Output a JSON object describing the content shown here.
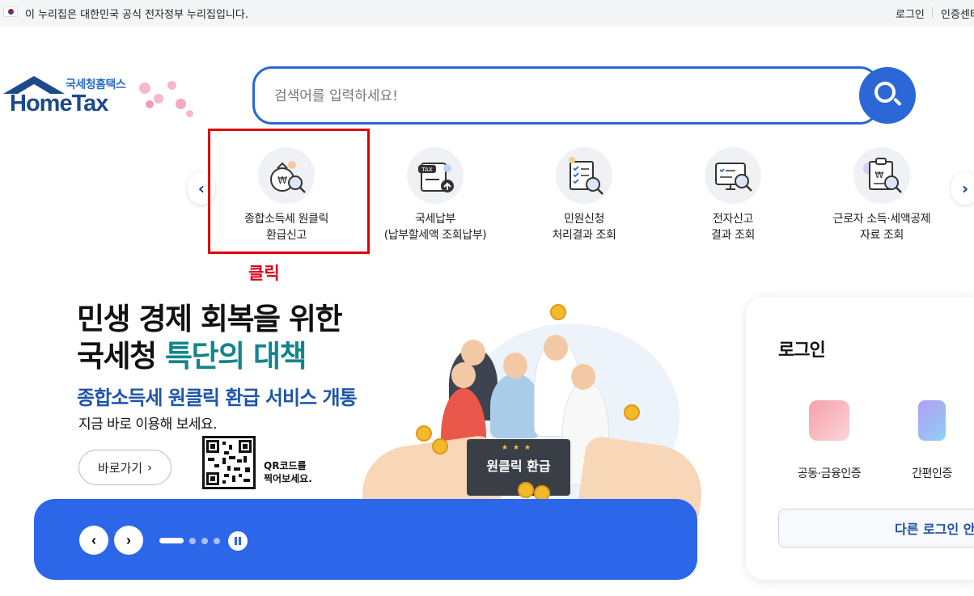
{
  "gov_banner": {
    "text": "이 누리집은 대한민국 공식 전자정부 누리집입니다.",
    "login": "로그인",
    "cert_center": "인증센터"
  },
  "logo": {
    "sub": "국세청홈택스",
    "main": "HomeTax"
  },
  "search": {
    "placeholder": "검색어를 입력하세요!"
  },
  "quick_menu": {
    "items": [
      {
        "line1": "종합소득세 원클릭",
        "line2": "환급신고",
        "icon": "money-bag-check-icon"
      },
      {
        "line1": "국세납부",
        "line2": "(납부할세액 조회납부)",
        "icon": "tax-document-upload-icon"
      },
      {
        "line1": "민원신청",
        "line2": "처리결과 조회",
        "icon": "checklist-search-icon"
      },
      {
        "line1": "전자신고",
        "line2": "결과 조회",
        "icon": "monitor-search-icon"
      },
      {
        "line1": "근로자 소득·세액공제",
        "line2": "자료 조회",
        "icon": "clipboard-won-search-icon"
      }
    ]
  },
  "annotation": {
    "click_note": "클릭",
    "highlight_color": "#e00000"
  },
  "banner": {
    "title_line1": "민생 경제 회복을 위한",
    "title_line2_a": "국세청 ",
    "title_line2_b": "특단의 대책",
    "subtitle": "종합소득세 원클릭 환급 서비스 개통",
    "desc": "지금 바로 이용해 보세요.",
    "go_button": "바로가기",
    "qr_note_line1": "QR코드를",
    "qr_note_line2": "찍어보세요.",
    "sign_text": "원클릭 환급",
    "sign_stars": "★★★",
    "slide_total": 4,
    "slide_current": 1
  },
  "login_panel": {
    "title": "로그인",
    "options": [
      {
        "label": "공동·금융인증",
        "icon": "certificate-card-icon"
      },
      {
        "label": "간편인증",
        "icon": "phone-auth-icon"
      }
    ],
    "other_login": "다른 로그인 안"
  },
  "colors": {
    "brand_blue": "#2b67d6",
    "bar_blue": "#2b67e8",
    "logo_navy": "#1b4a8c",
    "teal": "#13858c",
    "red": "#d8001a"
  }
}
